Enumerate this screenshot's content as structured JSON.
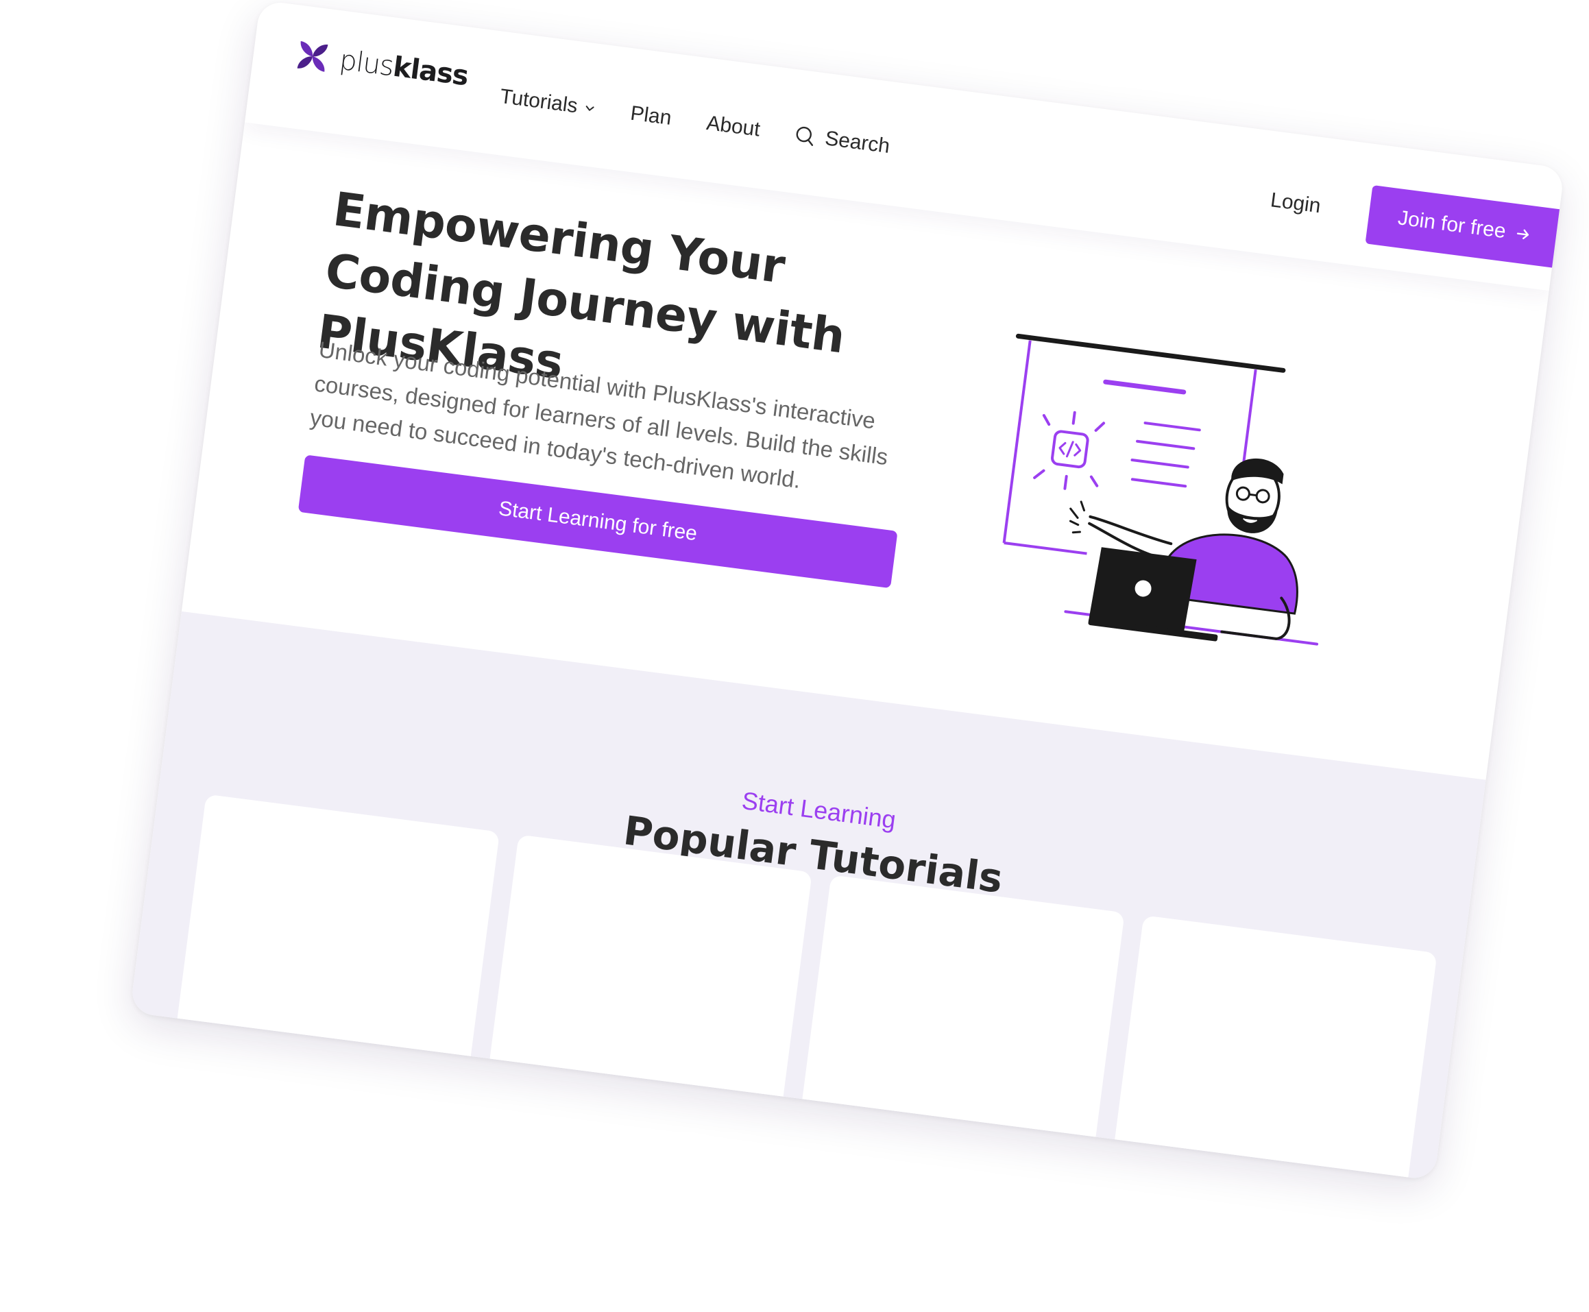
{
  "brand": {
    "logo_light": "plus",
    "logo_bold": "klass",
    "accent": "#9b3ff0",
    "logo_dark": "#4b1f8a"
  },
  "nav": {
    "tutorials": "Tutorials",
    "plan": "Plan",
    "about": "About",
    "search": "Search"
  },
  "auth": {
    "login": "Login",
    "join": "Join for free"
  },
  "hero": {
    "title": "Empowering Your Coding Journey with PlusKlass",
    "description": "Unlock your coding potential with PlusKlass's interactive courses, designed for learners of all levels. Build the skills you need to succeed in today's tech-driven world.",
    "cta": "Start Learning for free"
  },
  "tutorials": {
    "eyebrow": "Start Learning",
    "title": "Popular Tutorials",
    "card_count": 4
  },
  "icons": [
    "plusklass-logo-icon",
    "chevron-down-icon",
    "search-icon",
    "arrow-right-icon",
    "code-icon"
  ]
}
